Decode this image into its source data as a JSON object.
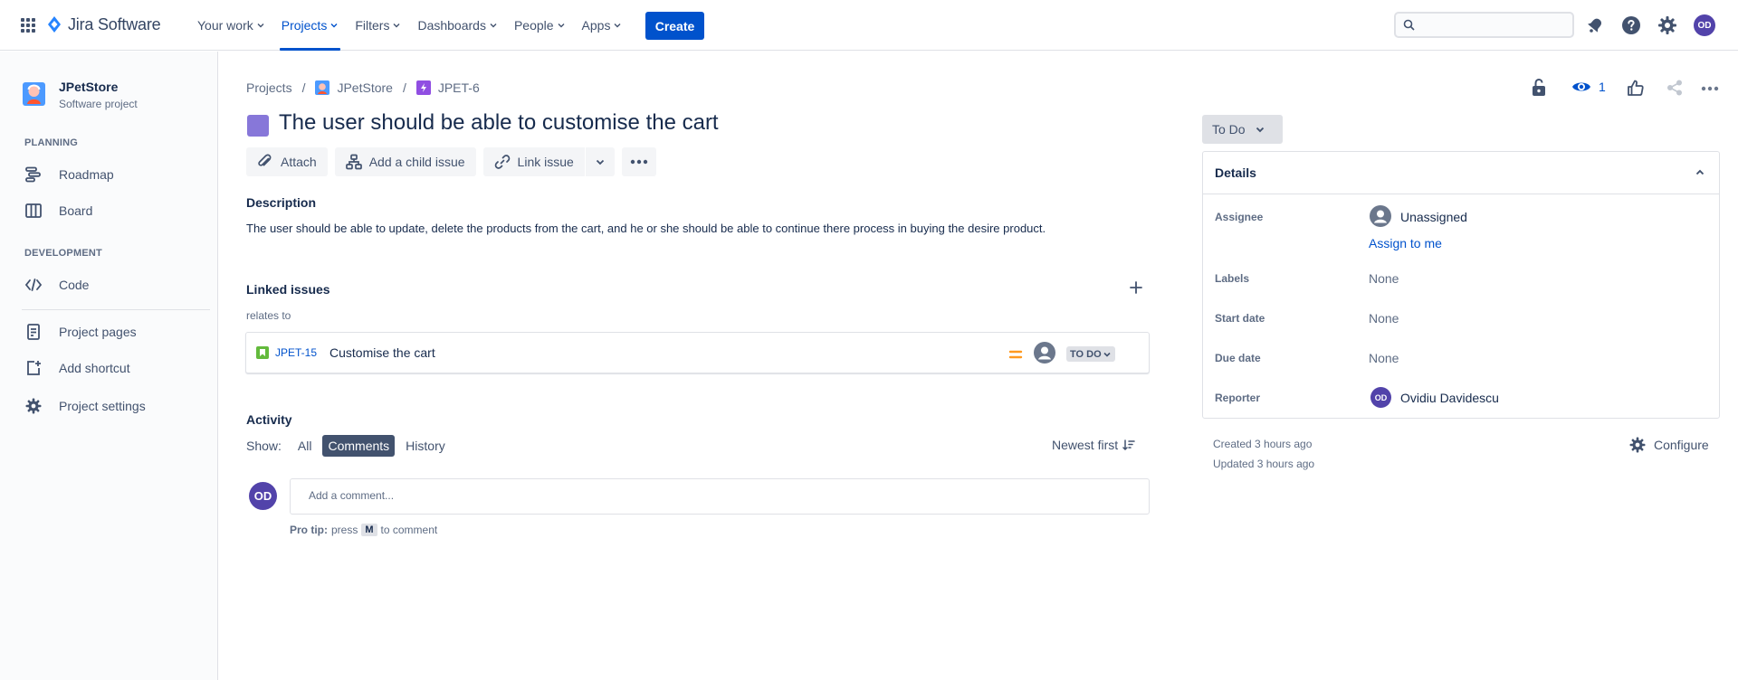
{
  "app": {
    "name": "Jira Software"
  },
  "topnav": {
    "items": [
      {
        "label": "Your work"
      },
      {
        "label": "Projects"
      },
      {
        "label": "Filters"
      },
      {
        "label": "Dashboards"
      },
      {
        "label": "People"
      },
      {
        "label": "Apps"
      }
    ],
    "create_label": "Create",
    "search_value": "",
    "avatar_initials": "OD"
  },
  "sidebar": {
    "project_name": "JPetStore",
    "project_type": "Software project",
    "planning_header": "PLANNING",
    "development_header": "DEVELOPMENT",
    "items": [
      {
        "label": "Roadmap"
      },
      {
        "label": "Board"
      },
      {
        "label": "Code"
      },
      {
        "label": "Project pages"
      },
      {
        "label": "Add shortcut"
      },
      {
        "label": "Project settings"
      }
    ]
  },
  "breadcrumb": {
    "projects": "Projects",
    "project": "JPetStore",
    "issue_key": "JPET-6"
  },
  "issue": {
    "title": "The user should be able to customise the cart",
    "type_color": "#8777d9",
    "actions": {
      "attach": "Attach",
      "add_child": "Add a child issue",
      "link": "Link issue"
    },
    "description_label": "Description",
    "description": "The user should be able to update, delete the products from the cart, and he or she should be able to continue there process in buying the desire product."
  },
  "linked_issues": {
    "header": "Linked issues",
    "relation": "relates to",
    "items": [
      {
        "key": "JPET-15",
        "summary": "Customise the cart",
        "priority": "medium",
        "status": "TO DO"
      }
    ]
  },
  "activity": {
    "header": "Activity",
    "show_label": "Show:",
    "filters": [
      "All",
      "Comments",
      "History"
    ],
    "selected_filter": "Comments",
    "sort_label": "Newest first",
    "avatar_initials": "OD",
    "comment_placeholder": "Add a comment...",
    "protip_bold": "Pro tip:",
    "protip_pre": "press",
    "protip_key": "M",
    "protip_post": "to comment"
  },
  "watch_count": "1",
  "status": {
    "label": "To Do"
  },
  "details": {
    "header": "Details",
    "assignee_label": "Assignee",
    "assignee_value": "Unassigned",
    "assign_to_me": "Assign to me",
    "labels_label": "Labels",
    "labels_value": "None",
    "start_date_label": "Start date",
    "start_date_value": "None",
    "due_date_label": "Due date",
    "due_date_value": "None",
    "reporter_label": "Reporter",
    "reporter_initials": "OD",
    "reporter_name": "Ovidiu Davidescu"
  },
  "meta": {
    "created": "Created 3 hours ago",
    "updated": "Updated 3 hours ago",
    "configure": "Configure"
  },
  "colors": {
    "brand": "#0052cc",
    "avatar": "#5243aa",
    "story": "#63ba3c",
    "priority_medium": "#ff991f"
  }
}
